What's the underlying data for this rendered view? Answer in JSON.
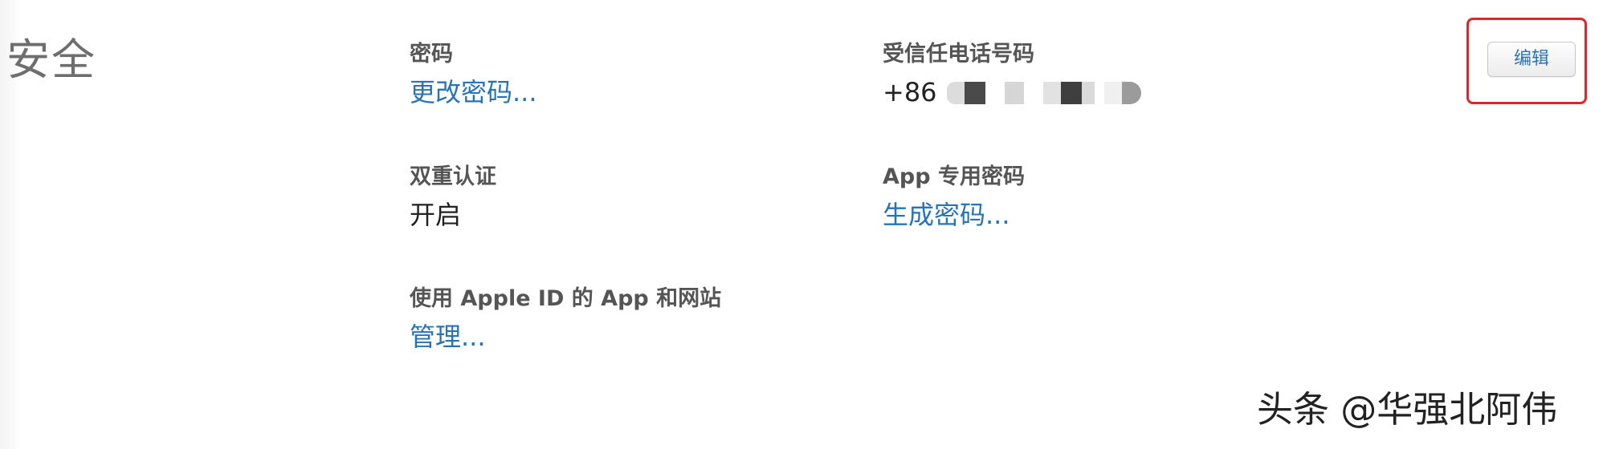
{
  "section": {
    "title": "安全"
  },
  "password": {
    "label": "密码",
    "action": "更改密码..."
  },
  "two_factor": {
    "label": "双重认证",
    "status": "开启"
  },
  "apps_using_apple_id": {
    "label": "使用 Apple ID 的 App 和网站",
    "action": "管理..."
  },
  "trusted_phone": {
    "label": "受信任电话号码",
    "prefix": "+86"
  },
  "app_passwords": {
    "label": "App 专用密码",
    "action": "生成密码..."
  },
  "edit_button": {
    "label": "编辑"
  },
  "watermark": {
    "text": "头条 @华强北阿伟"
  },
  "colors": {
    "link": "#2673b8",
    "highlight": "#e0262a",
    "title": "#6e6e6e",
    "label": "#555555"
  }
}
